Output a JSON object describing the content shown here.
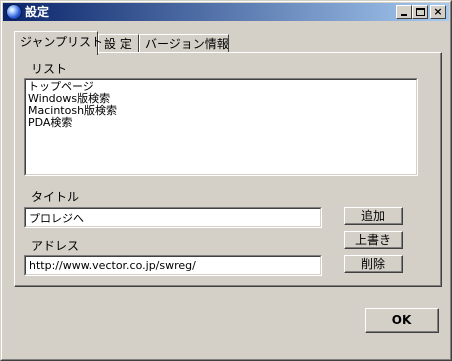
{
  "window": {
    "title": "設定",
    "minimize": "_",
    "maximize": "□",
    "close": "×"
  },
  "tabs": [
    {
      "label": "ジャンプリスト",
      "active": true
    },
    {
      "label": "設 定",
      "active": false
    },
    {
      "label": "バージョン情報",
      "active": false
    }
  ],
  "list": {
    "label": "リスト",
    "items": [
      "トップページ",
      "Windows版検索",
      "Macintosh版検索",
      "PDA検索"
    ]
  },
  "title_field": {
    "label": "タイトル",
    "value": "プロレジへ"
  },
  "address_field": {
    "label": "アドレス",
    "value": "http://www.vector.co.jp/swreg/"
  },
  "buttons": {
    "add": "追加",
    "overwrite": "上書き",
    "delete": "削除",
    "ok": "OK"
  },
  "colors": {
    "face": "#d4d0c8",
    "titlebar_start": "#0a246a",
    "titlebar_end": "#a6caf0"
  }
}
